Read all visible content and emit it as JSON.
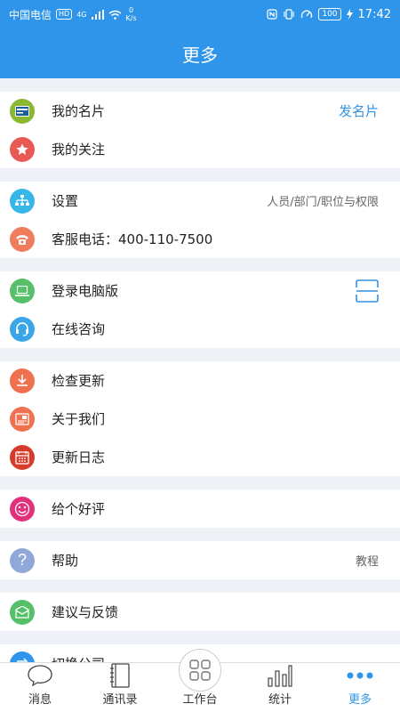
{
  "status_bar": {
    "carrier": "中国电信",
    "hd_badge": "HD",
    "network": "4G",
    "speed_value": "0",
    "speed_unit": "K/s",
    "battery": "100",
    "time": "17:42"
  },
  "header": {
    "title": "更多"
  },
  "groups": [
    {
      "items": [
        {
          "label": "我的名片",
          "right": "发名片",
          "icon": "business-card-icon",
          "color": "#8bb830"
        },
        {
          "label": "我的关注",
          "icon": "star-icon",
          "color": "#ea5a55"
        }
      ]
    },
    {
      "items": [
        {
          "label": "设置",
          "right": "人员/部门/职位与权限",
          "icon": "org-chart-icon",
          "color": "#37b7e8"
        },
        {
          "label": "客服电话：400-110-7500",
          "icon": "phone-icon",
          "color": "#ef7c5c"
        }
      ]
    },
    {
      "items": [
        {
          "label": "登录电脑版",
          "icon": "laptop-icon",
          "color": "#55bf6a"
        },
        {
          "label": "在线咨询",
          "icon": "headset-icon",
          "color": "#3aa6e8"
        }
      ]
    },
    {
      "items": [
        {
          "label": "检查更新",
          "icon": "download-icon",
          "color": "#ef7150"
        },
        {
          "label": "关于我们",
          "icon": "about-icon",
          "color": "#ef7150"
        },
        {
          "label": "更新日志",
          "icon": "calendar-icon",
          "color": "#d63c2c"
        }
      ]
    },
    {
      "items": [
        {
          "label": "给个好评",
          "icon": "smile-icon",
          "color": "#e2307c"
        }
      ]
    },
    {
      "items": [
        {
          "label": "帮助",
          "right": "教程",
          "icon": "question-icon",
          "color": "#8fa8d8"
        }
      ]
    },
    {
      "items": [
        {
          "label": "建议与反馈",
          "icon": "feedback-icon",
          "color": "#55bf6a"
        }
      ]
    },
    {
      "items": [
        {
          "label": "切换公司",
          "icon": "switch-icon",
          "color": "#2e95ea"
        }
      ]
    }
  ],
  "tabs": [
    {
      "label": "消息",
      "icon": "chat-bubble-icon"
    },
    {
      "label": "通讯录",
      "icon": "contacts-book-icon"
    },
    {
      "label": "工作台",
      "icon": "grid-icon"
    },
    {
      "label": "统计",
      "icon": "bar-chart-icon"
    },
    {
      "label": "更多",
      "icon": "more-dots-icon"
    }
  ],
  "colors": {
    "primary": "#2e95ea",
    "background": "#eef1f5"
  }
}
